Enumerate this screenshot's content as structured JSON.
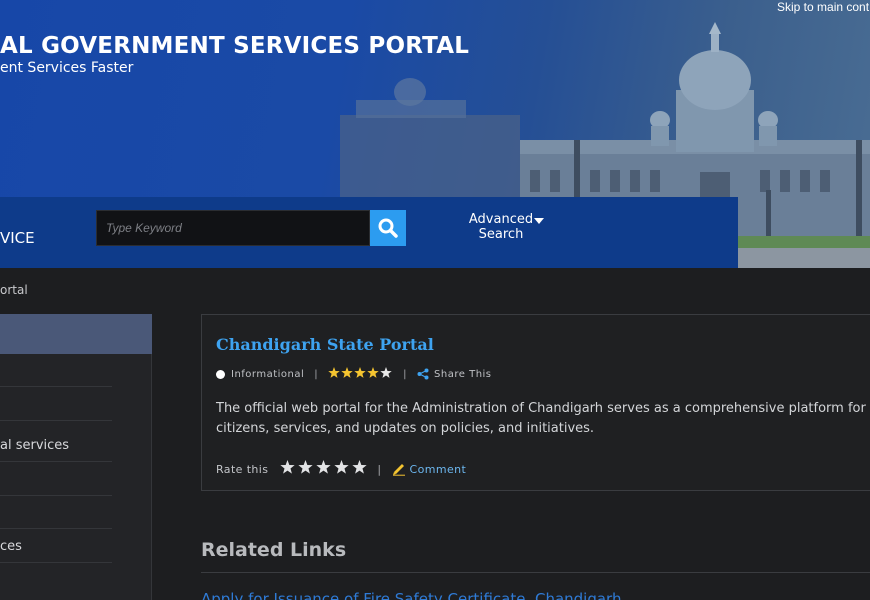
{
  "header": {
    "skip_link": "Skip to main cont",
    "title": "AL GOVERNMENT SERVICES PORTAL",
    "tagline": "ent Services Faster"
  },
  "search": {
    "service_label": "VICE",
    "placeholder": "Type Keyword",
    "advanced_label": "Advanced Search",
    "search_icon": "search-icon"
  },
  "breadcrumb": {
    "text": "ortal"
  },
  "sidebar": {
    "items": [
      {
        "label": ""
      },
      {
        "label": ""
      },
      {
        "label": ""
      },
      {
        "label": "al services"
      },
      {
        "label": ""
      },
      {
        "label": ""
      },
      {
        "label": "ces"
      }
    ]
  },
  "card": {
    "title": "Chandigarh State Portal",
    "type_label": "Informational",
    "rating": 4,
    "rating_max": 5,
    "share_label": "Share This",
    "description": "The official web portal for the Administration of Chandigarh serves as a comprehensive platform for citizens, services, and updates on policies, and initiatives.",
    "rate_label": "Rate this",
    "comment_label": "Comment"
  },
  "related": {
    "heading": "Related Links",
    "first_link": "Apply for Issuance of Fire Safety Certificate, Chandigarh"
  },
  "colors": {
    "banner": "#1a4aa6",
    "search_strip": "#0e3b8a",
    "accent": "#2c9cf0",
    "link": "#3ea3f0",
    "star_gold": "#f4c430",
    "sidebar_active": "#4a5878"
  }
}
